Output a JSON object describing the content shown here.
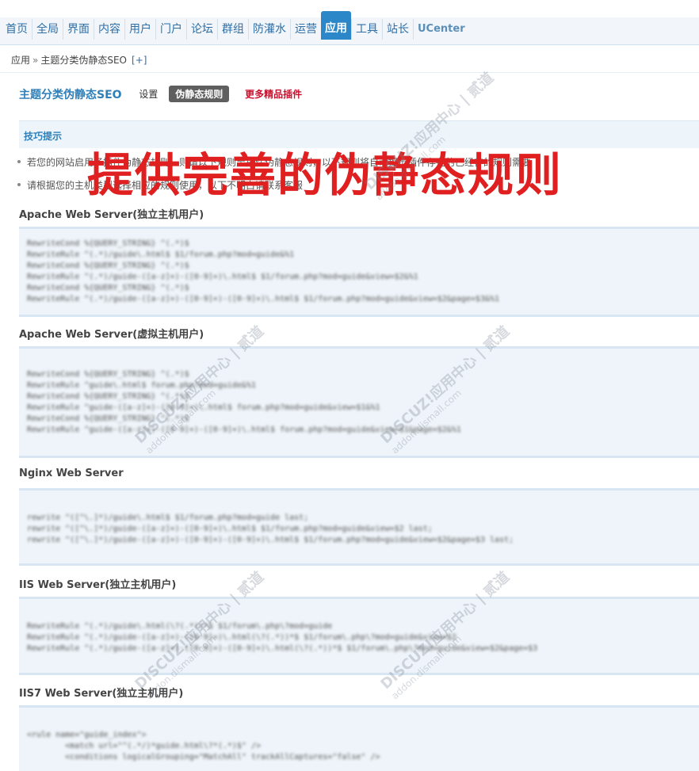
{
  "nav": {
    "items": [
      "首页",
      "全局",
      "界面",
      "内容",
      "用户",
      "门户",
      "论坛",
      "群组",
      "防灌水",
      "运营",
      "应用",
      "工具",
      "站长",
      "UCenter"
    ],
    "active": "应用"
  },
  "breadcrumb": {
    "root": "应用",
    "separator": "»",
    "current": "主题分类伪静态SEO",
    "add": "[+]"
  },
  "plugin": {
    "title": "主题分类伪静态SEO",
    "tabs": [
      "设置",
      "伪静态规则",
      "更多精品插件"
    ]
  },
  "tips": {
    "title": "技巧提示",
    "items": [
      "若您的网站启用了插件伪静态规则，则请以下规则至插件伪静态规则，以下规则将自动提示插件存在的已经存的规则需要",
      "请根据您的主机类型选择相应的规则使用，以下不明白请联系客服"
    ]
  },
  "banner": "提供完善的伪静态规则",
  "sections": [
    {
      "title": "Apache Web Server(独立主机用户)",
      "lines": [
        "RewriteCond %{QUERY_STRING} ^(.*)$",
        "RewriteRule ^(.*)/guide\\.html$ $1/forum.php?mod=guide&%1",
        "RewriteCond %{QUERY_STRING} ^(.*)$",
        "RewriteRule ^(.*)/guide-([a-z]+)-([0-9]+)\\.html$ $1/forum.php?mod=guide&view=$2&%1",
        "RewriteCond %{QUERY_STRING} ^(.*)$",
        "RewriteRule ^(.*)/guide-([a-z]+)-([0-9]+)-([0-9]+)\\.html$ $1/forum.php?mod=guide&view=$2&page=$3&%1"
      ]
    },
    {
      "title": "Apache Web Server(虚拟主机用户)",
      "lines": [
        "RewriteCond %{QUERY_STRING} ^(.*)$",
        "RewriteRule ^guide\\.html$ forum.php?mod=guide&%1",
        "RewriteCond %{QUERY_STRING} ^(.*)$",
        "RewriteRule ^guide-([a-z]+)-([0-9]+)\\.html$ forum.php?mod=guide&view=$1&%1",
        "RewriteCond %{QUERY_STRING} ^(.*)$",
        "RewriteRule ^guide-([a-z]+)-([0-9]+)-([0-9]+)\\.html$ forum.php?mod=guide&view=$1&page=$2&%1"
      ]
    },
    {
      "title": "Nginx Web Server",
      "lines": [
        "rewrite ^([^\\.]*)/guide\\.html$ $1/forum.php?mod=guide last;",
        "rewrite ^([^\\.]*)/guide-([a-z]+)-([0-9]+)\\.html$ $1/forum.php?mod=guide&view=$2 last;",
        "rewrite ^([^\\.]*)/guide-([a-z]+)-([0-9]+)-([0-9]+)\\.html$ $1/forum.php?mod=guide&view=$2&page=$3 last;"
      ]
    },
    {
      "title": "IIS Web Server(独立主机用户)",
      "lines": [
        "RewriteRule ^(.*)/guide\\.html(\\?(.*))*$ $1/forum\\.php\\?mod=guide",
        "RewriteRule ^(.*)/guide-([a-z]+)-([0-9]+)\\.html(\\?(.*))*$ $1/forum\\.php\\?mod=guide&view=$2",
        "RewriteRule ^(.*)/guide-([a-z]+)-([0-9]+)-([0-9]+)\\.html(\\?(.*))*$ $1/forum\\.php\\?mod=guide&view=$2&page=$3"
      ]
    },
    {
      "title": "IIS7 Web Server(独立主机用户)",
      "lines": [
        "<rule name=\"guide_index\">",
        "        <match url=\"^(.*/)*guide.html\\?*(.*)$\" />",
        "        <conditions logicalGrouping=\"MatchAll\" trackAllCaptures=\"false\" />"
      ]
    }
  ]
}
